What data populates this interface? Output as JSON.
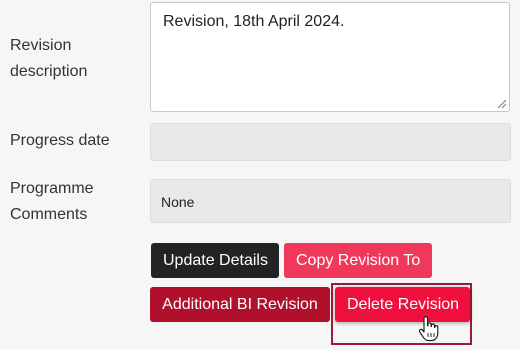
{
  "form": {
    "revision_description": {
      "label": "Revision description",
      "value": "Revision, 18th April 2024."
    },
    "progress_date": {
      "label": "Progress date",
      "value": ""
    },
    "programme_comments": {
      "label": "Programme Comments",
      "value": "None"
    }
  },
  "actions": {
    "update_details": "Update Details",
    "copy_revision_to": "Copy Revision To",
    "additional_bi_revision": "Additional BI Revision",
    "delete_revision": "Delete Revision"
  },
  "colors": {
    "dark_button": "#232323",
    "pink_button": "#f0385a",
    "maroon_button": "#b0102c",
    "red_button": "#f0103e",
    "focus_outline": "#9e1a3a"
  },
  "icons": {
    "cursor": "hand-pointer-icon",
    "resize": "resize-grip-icon"
  }
}
